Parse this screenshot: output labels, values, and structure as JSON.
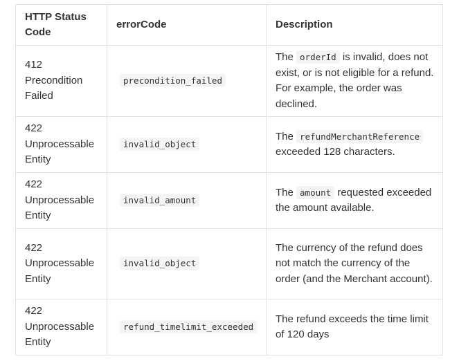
{
  "table": {
    "headers": {
      "status": "HTTP Status Code",
      "error_code": "errorCode",
      "description": "Description"
    },
    "rows": [
      {
        "status_code": "412",
        "status_text": "Precondition Failed",
        "error_code": "precondition_failed",
        "description": {
          "before": "The ",
          "code": "orderId",
          "after": " is invalid, does not exist, or is not eligible for a refund. For example, the order was declined."
        }
      },
      {
        "status_code": "422",
        "status_text": "Unprocessable Entity",
        "error_code": "invalid_object",
        "description": {
          "before": "The ",
          "code": "refundMerchantReference",
          "after": " exceeded 128 characters."
        }
      },
      {
        "status_code": "422",
        "status_text": "Unprocessable Entity",
        "error_code": "invalid_amount",
        "description": {
          "before": "The ",
          "code": "amount",
          "after": " requested exceeded the amount available."
        }
      },
      {
        "status_code": "422",
        "status_text": "Unprocessable Entity",
        "error_code": "invalid_object",
        "description": {
          "before": "The currency of the refund does not match the currency of the order (and the Merchant account).",
          "code": "",
          "after": ""
        }
      },
      {
        "status_code": "422",
        "status_text": "Unprocessable Entity",
        "error_code": "refund_timelimit_exceeded",
        "description": {
          "before": "The refund exceeds the time limit of 120 days",
          "code": "",
          "after": ""
        }
      }
    ]
  }
}
